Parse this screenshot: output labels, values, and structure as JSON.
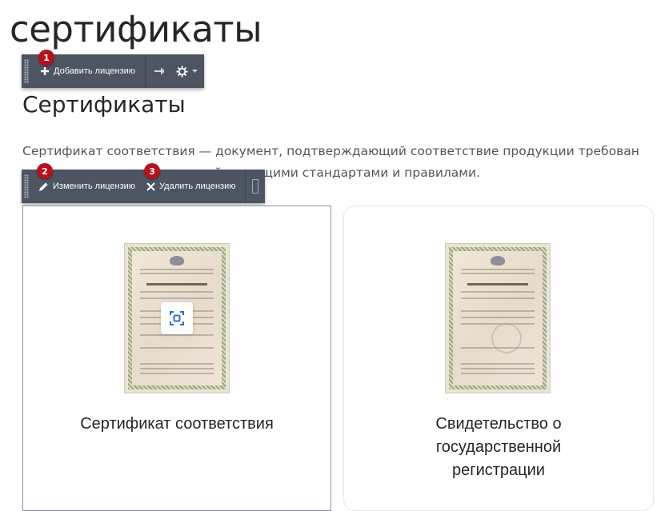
{
  "page": {
    "heading": "сертификаты"
  },
  "toolbar_top": {
    "add_label": "Добавить лицензию",
    "badge": "1"
  },
  "section": {
    "title": "Сертификаты",
    "description_line1": "Сертификат соответствия — документ, подтверждающий соответствие продукции требован",
    "description_line2": "установленными в стране действующими стандартами и правилами."
  },
  "toolbar_item": {
    "edit_label": "Изменить лицензию",
    "edit_badge": "2",
    "delete_label": "Удалить лицензию",
    "delete_badge": "3"
  },
  "cards": [
    {
      "title": "Сертификат соответствия"
    },
    {
      "title_lines": [
        "Свидетельство о",
        "государственной",
        "регистрации"
      ]
    }
  ],
  "icons": {
    "add": "plus-icon",
    "pin": "pin-icon",
    "settings": "gear-icon",
    "edit": "pencil-icon",
    "delete": "close-icon",
    "zoom": "zoom-icon"
  },
  "colors": {
    "toolbar_bg": "#4d5562",
    "badge_bg": "#b5121b",
    "zoom_icon": "#1f73d9"
  }
}
